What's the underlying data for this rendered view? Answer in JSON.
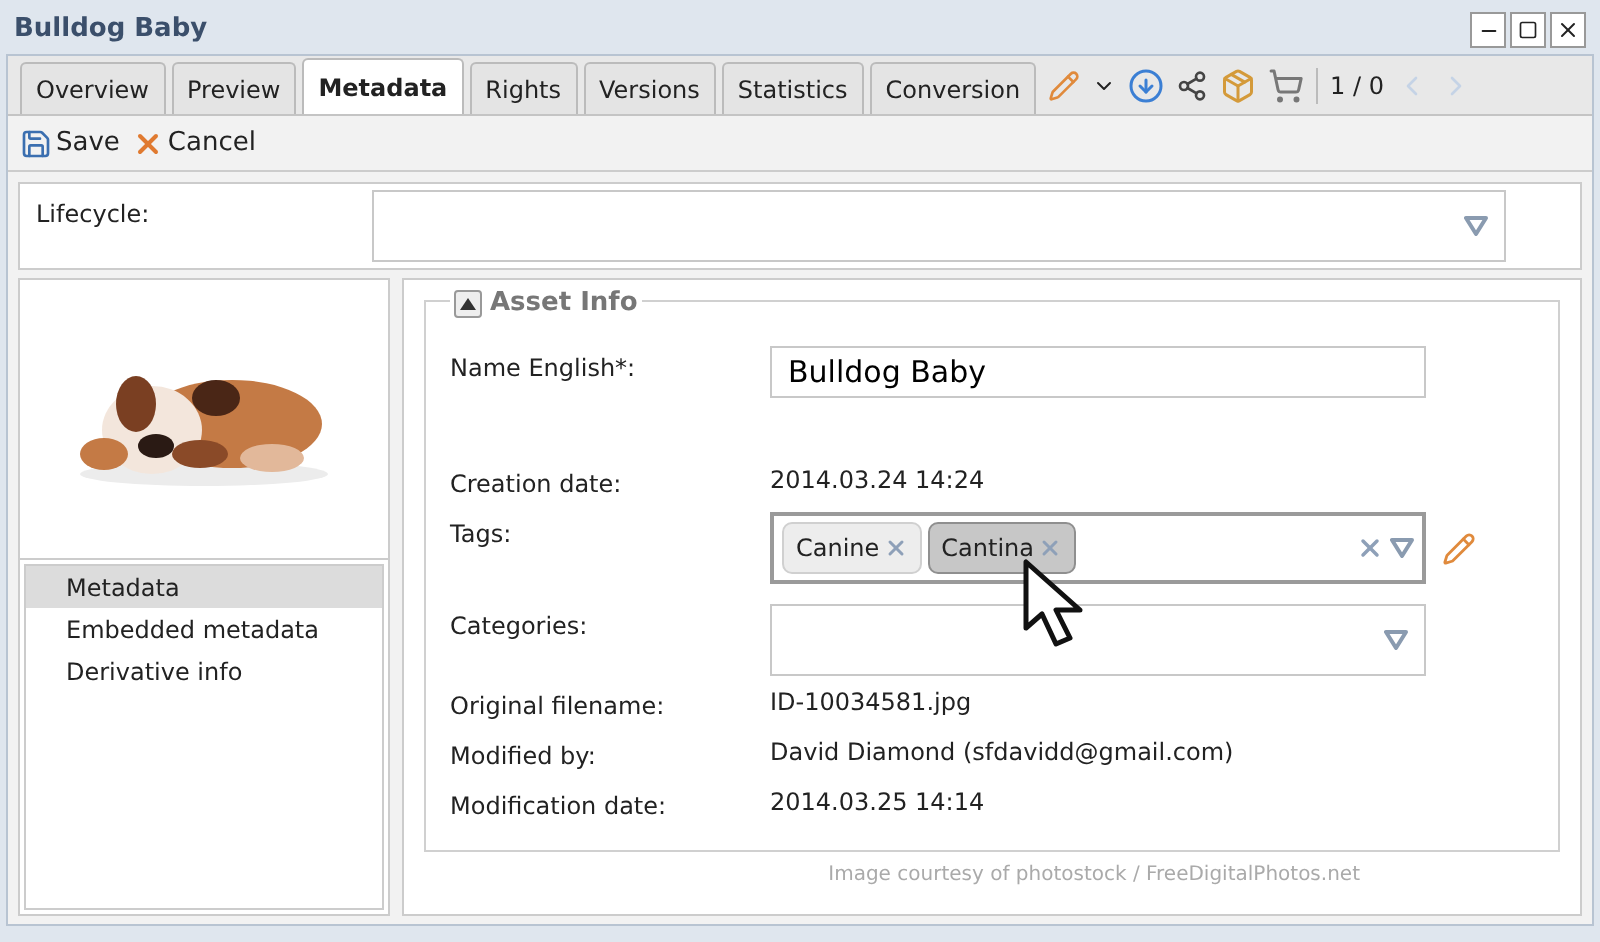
{
  "window": {
    "title": "Bulldog Baby"
  },
  "tabs": [
    {
      "label": "Overview",
      "selected": false
    },
    {
      "label": "Preview",
      "selected": false
    },
    {
      "label": "Metadata",
      "selected": true
    },
    {
      "label": "Rights",
      "selected": false
    },
    {
      "label": "Versions",
      "selected": false
    },
    {
      "label": "Statistics",
      "selected": false
    },
    {
      "label": "Conversion",
      "selected": false
    }
  ],
  "pager": {
    "text": "1 / 0",
    "prev_disabled": true,
    "next_disabled": true
  },
  "toolbar": [
    "Save",
    "Cancel"
  ],
  "lifecycle": {
    "label": "Lifecycle:"
  },
  "nav": [
    {
      "label": "Metadata",
      "selected": true
    },
    {
      "label": "Embedded metadata",
      "selected": false
    },
    {
      "label": "Derivative info",
      "selected": false
    }
  ],
  "section": {
    "title": "Asset Info",
    "expanded": true
  },
  "fields": [
    {
      "kind": "text",
      "label": "Name English*:",
      "value": "Bulldog Baby"
    },
    {
      "kind": "static",
      "label": "Creation date:",
      "value": "2014.03.24 14:24"
    },
    {
      "kind": "tags",
      "label": "Tags:",
      "tags": [
        {
          "label": "Canine",
          "selected": false
        },
        {
          "label": "Cantina",
          "selected": true
        }
      ]
    },
    {
      "kind": "combo",
      "label": "Categories:"
    },
    {
      "kind": "static",
      "label": "Original filename:",
      "value": "ID-10034581.jpg"
    },
    {
      "kind": "static",
      "label": "Modified by:",
      "value": "David Diamond (sfdavidd@gmail.com)"
    },
    {
      "kind": "static",
      "label": "Modification date:",
      "value": "2014.03.25 14:14"
    }
  ],
  "credit": "Image courtesy of photostock / FreeDigitalPhotos.net"
}
